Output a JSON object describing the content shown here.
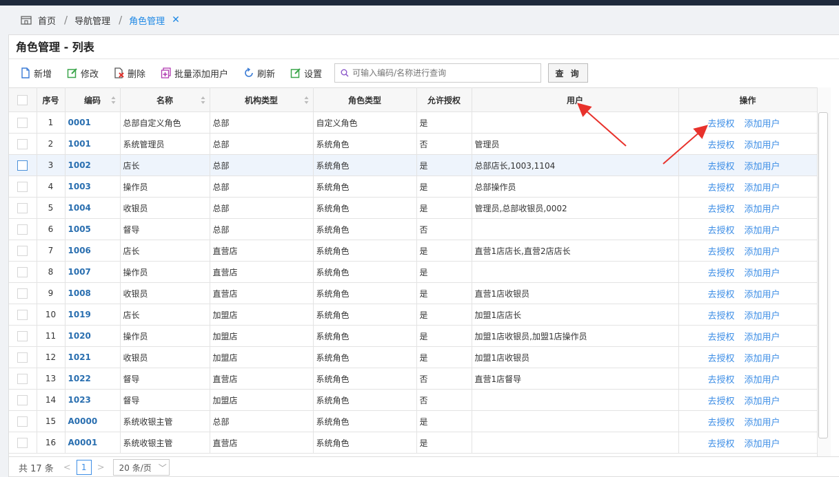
{
  "breadcrumb": {
    "home": "首页",
    "nav": "导航管理",
    "current": "角色管理"
  },
  "page_title": "角色管理 - 列表",
  "toolbar": {
    "add": "新增",
    "edit": "修改",
    "delete": "删除",
    "batch_add_user": "批量添加用户",
    "refresh": "刷新",
    "settings": "设置",
    "search_placeholder": "可输入编码/名称进行查询",
    "query": "查 询"
  },
  "columns": {
    "no": "序号",
    "code": "编码",
    "name": "名称",
    "org_type": "机构类型",
    "role_type": "角色类型",
    "allow_auth": "允许授权",
    "users": "用户",
    "ops": "操作"
  },
  "ops": {
    "authorize": "去授权",
    "add_user": "添加用户"
  },
  "rows": [
    {
      "no": "1",
      "code": "0001",
      "name": "总部自定义角色",
      "org": "总部",
      "role": "自定义角色",
      "allow": "是",
      "users": ""
    },
    {
      "no": "2",
      "code": "1001",
      "name": "系统管理员",
      "org": "总部",
      "role": "系统角色",
      "allow": "否",
      "users": "管理员"
    },
    {
      "no": "3",
      "code": "1002",
      "name": "店长",
      "org": "总部",
      "role": "系统角色",
      "allow": "是",
      "users": "总部店长,1003,1104"
    },
    {
      "no": "4",
      "code": "1003",
      "name": "操作员",
      "org": "总部",
      "role": "系统角色",
      "allow": "是",
      "users": "总部操作员"
    },
    {
      "no": "5",
      "code": "1004",
      "name": "收银员",
      "org": "总部",
      "role": "系统角色",
      "allow": "是",
      "users": "管理员,总部收银员,0002"
    },
    {
      "no": "6",
      "code": "1005",
      "name": "督导",
      "org": "总部",
      "role": "系统角色",
      "allow": "否",
      "users": ""
    },
    {
      "no": "7",
      "code": "1006",
      "name": "店长",
      "org": "直营店",
      "role": "系统角色",
      "allow": "是",
      "users": "直营1店店长,直营2店店长"
    },
    {
      "no": "8",
      "code": "1007",
      "name": "操作员",
      "org": "直营店",
      "role": "系统角色",
      "allow": "是",
      "users": ""
    },
    {
      "no": "9",
      "code": "1008",
      "name": "收银员",
      "org": "直营店",
      "role": "系统角色",
      "allow": "是",
      "users": "直营1店收银员"
    },
    {
      "no": "10",
      "code": "1019",
      "name": "店长",
      "org": "加盟店",
      "role": "系统角色",
      "allow": "是",
      "users": "加盟1店店长"
    },
    {
      "no": "11",
      "code": "1020",
      "name": "操作员",
      "org": "加盟店",
      "role": "系统角色",
      "allow": "是",
      "users": "加盟1店收银员,加盟1店操作员"
    },
    {
      "no": "12",
      "code": "1021",
      "name": "收银员",
      "org": "加盟店",
      "role": "系统角色",
      "allow": "是",
      "users": "加盟1店收银员"
    },
    {
      "no": "13",
      "code": "1022",
      "name": "督导",
      "org": "直营店",
      "role": "系统角色",
      "allow": "否",
      "users": "直营1店督导"
    },
    {
      "no": "14",
      "code": "1023",
      "name": "督导",
      "org": "加盟店",
      "role": "系统角色",
      "allow": "否",
      "users": ""
    },
    {
      "no": "15",
      "code": "A0000",
      "name": "系统收银主管",
      "org": "总部",
      "role": "系统角色",
      "allow": "是",
      "users": ""
    },
    {
      "no": "16",
      "code": "A0001",
      "name": "系统收银主管",
      "org": "直营店",
      "role": "系统角色",
      "allow": "是",
      "users": ""
    }
  ],
  "highlighted_row": "3",
  "pager": {
    "total": "共 17 条",
    "prev": "<",
    "page": "1",
    "next": ">",
    "page_size": "20 条/页"
  },
  "colors": {
    "accent": "#1e88e5",
    "link": "#3d8ee6",
    "annotation_arrow": "#e8322c"
  }
}
